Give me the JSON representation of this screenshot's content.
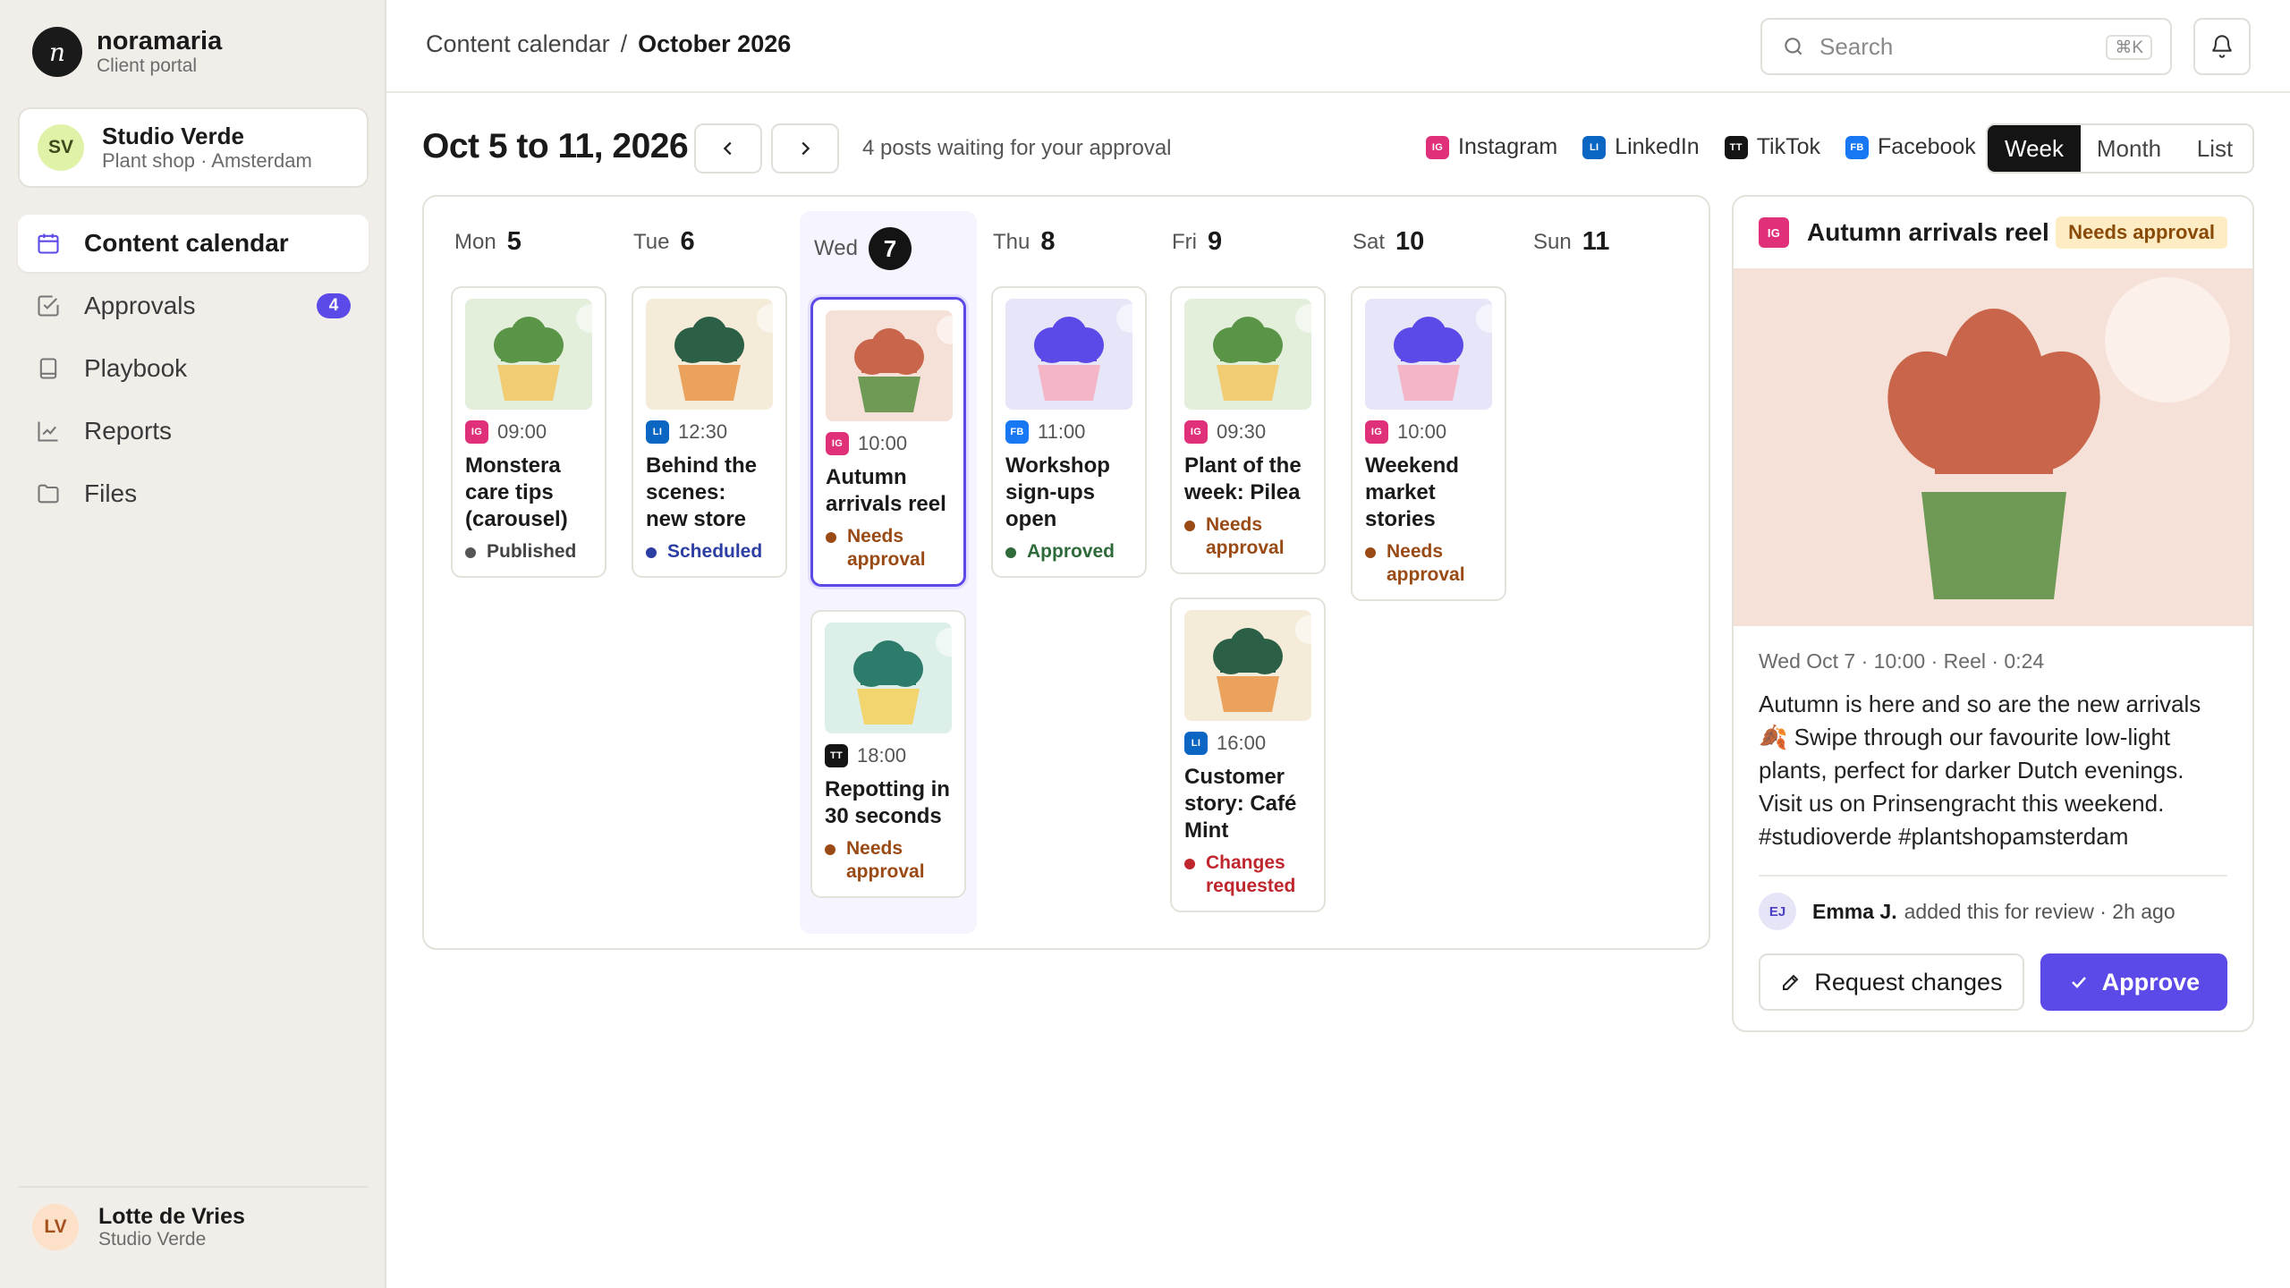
{
  "brand": {
    "logo_letter": "n",
    "name": "noramaria",
    "subtitle": "Client portal"
  },
  "client": {
    "initials": "SV",
    "name": "Studio Verde",
    "subtitle": "Plant shop · Amsterdam"
  },
  "nav": [
    {
      "label": "Content calendar",
      "icon": "calendar-icon",
      "active": true
    },
    {
      "label": "Approvals",
      "icon": "checkbox-icon",
      "badge": "4"
    },
    {
      "label": "Playbook",
      "icon": "book-icon"
    },
    {
      "label": "Reports",
      "icon": "chart-line-icon"
    },
    {
      "label": "Files",
      "icon": "folder-icon"
    }
  ],
  "user": {
    "initials": "LV",
    "name": "Lotte de Vries",
    "subtitle": "Studio Verde"
  },
  "breadcrumb": {
    "parent": "Content calendar",
    "separator": "/",
    "current": "October 2026"
  },
  "search": {
    "placeholder": "Search",
    "shortcut": "⌘K"
  },
  "week": {
    "title": "Oct 5 to 11, 2026",
    "pending": "4 posts waiting for your approval"
  },
  "channels": [
    {
      "code": "IG",
      "label": "Instagram"
    },
    {
      "code": "LI",
      "label": "LinkedIn"
    },
    {
      "code": "TT",
      "label": "TikTok"
    },
    {
      "code": "FB",
      "label": "Facebook"
    }
  ],
  "views": [
    "Week",
    "Month",
    "List"
  ],
  "active_view": "Week",
  "days": [
    {
      "dow": "Mon",
      "num": "5"
    },
    {
      "dow": "Tue",
      "num": "6"
    },
    {
      "dow": "Wed",
      "num": "7",
      "today": true
    },
    {
      "dow": "Thu",
      "num": "8"
    },
    {
      "dow": "Fri",
      "num": "9"
    },
    {
      "dow": "Sat",
      "num": "10"
    },
    {
      "dow": "Sun",
      "num": "11"
    }
  ],
  "posts": [
    {
      "day": "Mon",
      "channel": "IG",
      "time": "09:00",
      "title": "Monstera care tips (carousel)",
      "status": "Published",
      "colors": {
        "bg": "#e3eedb",
        "leaf": "#5a9446",
        "pot": "#f2cc72"
      }
    },
    {
      "day": "Tue",
      "channel": "LI",
      "time": "12:30",
      "title": "Behind the scenes: new store",
      "status": "Scheduled",
      "colors": {
        "bg": "#f4ebd9",
        "leaf": "#2b5f46",
        "pot": "#eba25c"
      }
    },
    {
      "day": "Wed",
      "channel": "IG",
      "time": "10:00",
      "title": "Autumn arrivals reel",
      "status": "Needs approval",
      "selected": true,
      "colors": {
        "bg": "#f5e1d8",
        "leaf": "#c8654a",
        "pot": "#6e9a56"
      }
    },
    {
      "day": "Wed",
      "channel": "TT",
      "time": "18:00",
      "title": "Repotting in 30 seconds",
      "status": "Needs approval",
      "colors": {
        "bg": "#dcefe9",
        "leaf": "#2d7b6a",
        "pot": "#f2d56e"
      }
    },
    {
      "day": "Thu",
      "channel": "FB",
      "time": "11:00",
      "title": "Workshop sign-ups open",
      "status": "Approved",
      "colors": {
        "bg": "#e6e6f8",
        "leaf": "#5b4ae8",
        "pot": "#f4b6c6"
      }
    },
    {
      "day": "Fri",
      "channel": "IG",
      "time": "09:30",
      "title": "Plant of the week: Pilea",
      "status": "Needs approval",
      "colors": {
        "bg": "#e3eedb",
        "leaf": "#5a9446",
        "pot": "#f2cc72"
      }
    },
    {
      "day": "Fri",
      "channel": "LI",
      "time": "16:00",
      "title": "Customer story: Café Mint",
      "status": "Changes requested",
      "colors": {
        "bg": "#f4ebd9",
        "leaf": "#2b5f46",
        "pot": "#eba25c"
      }
    },
    {
      "day": "Sat",
      "channel": "IG",
      "time": "10:00",
      "title": "Weekend market stories",
      "status": "Needs approval",
      "colors": {
        "bg": "#e6e6f8",
        "leaf": "#5b4ae8",
        "pot": "#f4b6c6"
      }
    }
  ],
  "detail": {
    "channel": "IG",
    "title": "Autumn arrivals reel",
    "badge": "Needs approval",
    "meta": "Wed Oct 7 · 10:00 · Reel · 0:24",
    "body": "Autumn is here and so are the new arrivals 🍂 Swipe through our favourite low-light plants, perfect for darker Dutch evenings. Visit us on Prinsengracht this weekend. #studioverde #plantshopamsterdam",
    "reviewer": {
      "initials": "EJ",
      "name": "Emma J.",
      "action": "added this for review · 2h ago"
    },
    "actions": {
      "secondary": "Request changes",
      "primary": "Approve"
    },
    "colors": {
      "bg": "#f5e1d8",
      "leaf": "#c8654a",
      "pot": "#6e9a56",
      "sun": "#fbf1ea"
    }
  },
  "colors": {
    "accent": "#5b4ae8",
    "instagram": "#e0307a",
    "linkedin": "#0a66c2",
    "tiktok": "#141414",
    "facebook": "#1877f2"
  }
}
